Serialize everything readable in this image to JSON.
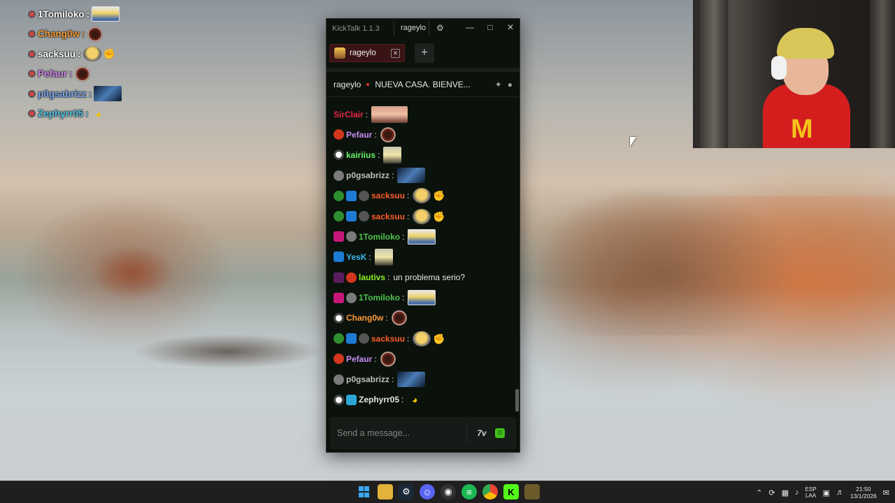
{
  "window": {
    "app_name": "KickTalk 1.1.3",
    "title_user": "rageylo"
  },
  "tabs": [
    {
      "label": "rageylo"
    }
  ],
  "channel": {
    "name": "rageylo",
    "stream_title": "NUEVA CASA. BIENVE..."
  },
  "messages": [
    {
      "user": "SirClair",
      "color": "#e8264a",
      "badges": [],
      "text": "",
      "emote": "portrait"
    },
    {
      "user": "Pefaur",
      "color": "#c58cf2",
      "badges": [
        "red"
      ],
      "text": "",
      "emote": "donut"
    },
    {
      "user": "kairiius",
      "color": "#6af26a",
      "badges": [
        "ring"
      ],
      "text": "",
      "emote": "skull"
    },
    {
      "user": "p0gsabrizz",
      "color": "#bfbfbf",
      "badges": [
        "skull"
      ],
      "text": "",
      "emote": "blue"
    },
    {
      "user": "sacksuu",
      "color": "#ff5a2a",
      "badges": [
        "green",
        "blue",
        "grey"
      ],
      "text": "",
      "emote": "face-muscle"
    },
    {
      "user": "sacksuu",
      "color": "#ff5a2a",
      "badges": [
        "green",
        "blue",
        "grey"
      ],
      "text": "",
      "emote": "face-muscle"
    },
    {
      "user": "1Tomiloko",
      "color": "#4ec24e",
      "badges": [
        "pink",
        "skull"
      ],
      "text": "",
      "emote": "minion"
    },
    {
      "user": "YesK",
      "color": "#3bb8f0",
      "badges": [
        "blue"
      ],
      "text": "",
      "emote": "skull"
    },
    {
      "user": "lautivs",
      "color": "#8cf02a",
      "badges": [
        "vip",
        "red"
      ],
      "text": "un problema serio?",
      "emote": ""
    },
    {
      "user": "1Tomiloko",
      "color": "#4ec24e",
      "badges": [
        "pink",
        "skull"
      ],
      "text": "",
      "emote": "minion"
    },
    {
      "user": "Chang0w",
      "color": "#ff9a3c",
      "badges": [
        "ring"
      ],
      "text": "",
      "emote": "donut"
    },
    {
      "user": "sacksuu",
      "color": "#ff5a2a",
      "badges": [
        "green",
        "blue",
        "grey"
      ],
      "text": "",
      "emote": "face-muscle"
    },
    {
      "user": "Pefaur",
      "color": "#c58cf2",
      "badges": [
        "red"
      ],
      "text": "",
      "emote": "donut"
    },
    {
      "user": "p0gsabrizz",
      "color": "#bfbfbf",
      "badges": [
        "skull"
      ],
      "text": "",
      "emote": "blue"
    },
    {
      "user": "Zephyrr05",
      "color": "#e6e6e6",
      "badges": [
        "ring",
        "cube"
      ],
      "text": "",
      "emote": "duck"
    }
  ],
  "input": {
    "placeholder": "Send a message..."
  },
  "overlay": [
    {
      "user": "1Tomiloko",
      "color": "#ffffff",
      "emote": "minion"
    },
    {
      "user": "Chang0w",
      "color": "#f39c3a",
      "emote": "donut"
    },
    {
      "user": "sacksuu",
      "color": "#ffffff",
      "emote": "face-muscle"
    },
    {
      "user": "Pefaur",
      "color": "#d28cf2",
      "emote": "donut"
    },
    {
      "user": "p0gsabrizz",
      "color": "#7aa8f0",
      "emote": "blue"
    },
    {
      "user": "Zephyrr05",
      "color": "#56c7e8",
      "emote": "duck"
    }
  ],
  "taskbar": {
    "lang_top": "ESP",
    "lang_bottom": "LAA",
    "time": "21:50",
    "date": "13/1/2026"
  },
  "icons": {
    "settings": "gear-icon",
    "minimize": "minimize-icon",
    "maximize": "maximize-icon",
    "close": "close-icon",
    "add_tab": "plus-icon",
    "pin": "pin-icon",
    "user": "user-icon",
    "seventv": "7tv-icon",
    "kick_emote": "kick-emote-icon"
  }
}
